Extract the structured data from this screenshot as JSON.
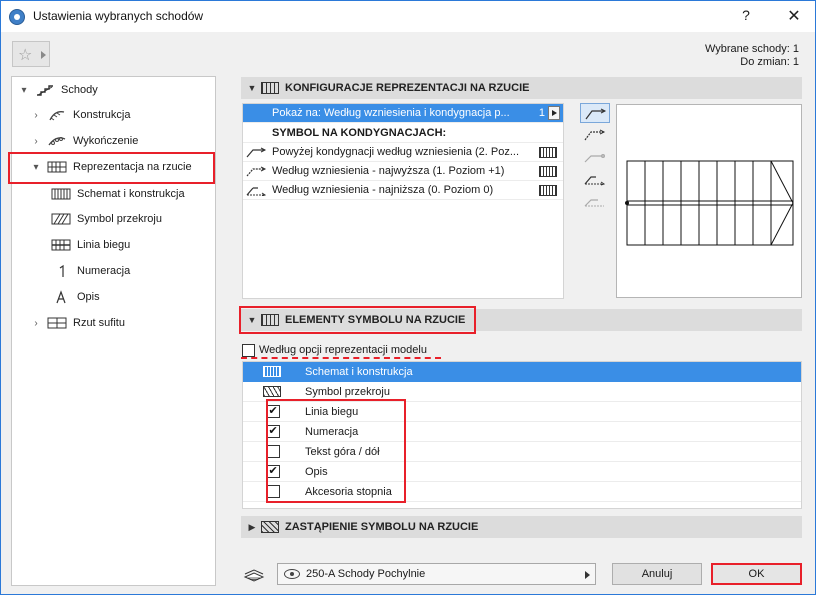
{
  "window": {
    "title": "Ustawienia wybranych schodów",
    "help": "?",
    "close": "✕"
  },
  "selection_info": {
    "selected": "Wybrane schody: 1",
    "to_change": "Do zmian: 1"
  },
  "tree": {
    "items": [
      {
        "label": "Schody",
        "level": 0,
        "expander": "▾",
        "icon": "stair-icon"
      },
      {
        "label": "Konstrukcja",
        "level": 1,
        "expander": "›",
        "icon": "structure-icon"
      },
      {
        "label": "Wykończenie",
        "level": 1,
        "expander": "›",
        "icon": "finish-icon"
      },
      {
        "label": "Reprezentacja na rzucie",
        "level": 1,
        "expander": "▾",
        "icon": "floor-plan-icon",
        "selected": true
      },
      {
        "label": "Schemat i konstrukcja",
        "level": 2,
        "icon": "scheme-icon"
      },
      {
        "label": "Symbol przekroju",
        "level": 2,
        "icon": "cut-symbol-icon"
      },
      {
        "label": "Linia biegu",
        "level": 2,
        "icon": "walking-line-icon"
      },
      {
        "label": "Numeracja",
        "level": 2,
        "icon": "numbering-icon"
      },
      {
        "label": "Opis",
        "level": 2,
        "icon": "description-icon"
      },
      {
        "label": "Rzut sufitu",
        "level": 1,
        "expander": "›",
        "icon": "ceiling-plan-icon"
      }
    ]
  },
  "config_section": {
    "title": "KONFIGURACJE REPREZENTACJI NA RZUCIE",
    "show_on": "Pokaż na: Według wzniesienia i kondygnacja p...",
    "show_on_count": "1",
    "symbol_header": "SYMBOL NA KONDYGNACJACH:",
    "rows": [
      {
        "label": "Powyżej kondygnacji według wzniesienia (2. Poz..."
      },
      {
        "label": "Według wzniesienia - najwyższa (1. Poziom +1)"
      },
      {
        "label": "Według wzniesienia - najniższa (0. Poziom 0)"
      }
    ]
  },
  "elements_section": {
    "title": "ELEMENTY SYMBOLU NA RZUCIE",
    "model_option": {
      "label": "Według opcji reprezentacji modelu",
      "checked": false
    },
    "rows": [
      {
        "label": "Schemat i konstrukcja",
        "kind": "icon",
        "highlight": true
      },
      {
        "label": "Symbol przekroju",
        "kind": "icon"
      },
      {
        "label": "Linia biegu",
        "kind": "checkbox",
        "checked": true
      },
      {
        "label": "Numeracja",
        "kind": "checkbox",
        "checked": true
      },
      {
        "label": "Tekst góra / dół",
        "kind": "checkbox",
        "checked": false
      },
      {
        "label": "Opis",
        "kind": "checkbox",
        "checked": true
      },
      {
        "label": "Akcesoria stopnia",
        "kind": "checkbox",
        "checked": false
      }
    ]
  },
  "override_section": {
    "title": "ZASTĄPIENIE SYMBOLU NA RZUCIE"
  },
  "footer": {
    "layer_value": "250-A Schody Pochylnie",
    "cancel": "Anuluj",
    "ok": "OK"
  },
  "colors": {
    "highlight": "#3a8ee6",
    "callout": "#e8202a",
    "header_bg": "#dcdcdc"
  }
}
